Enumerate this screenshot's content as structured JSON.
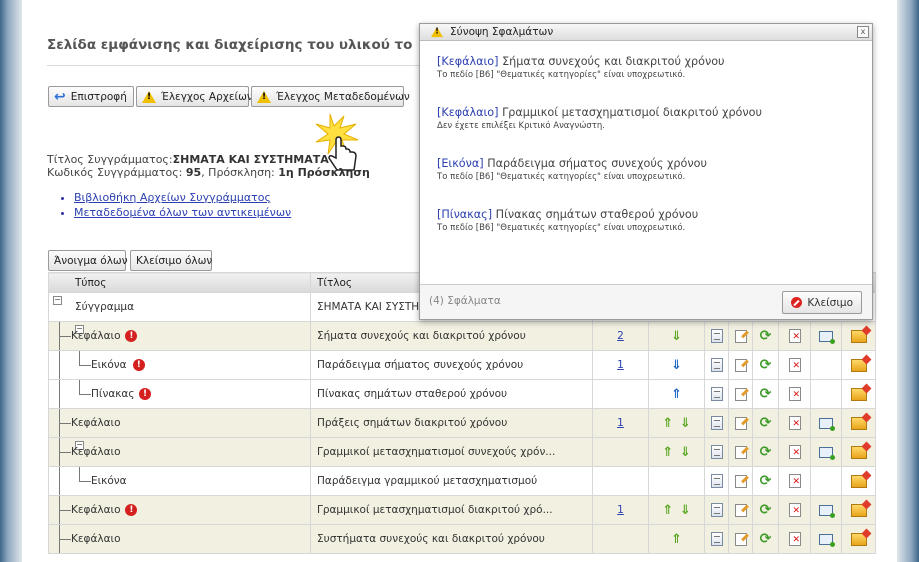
{
  "page": {
    "title": "Σελίδα εμφάνισης και διαχείρισης του υλικού το",
    "buttons": {
      "back": "Επιστροφή",
      "check_files": "Έλεγχος Αρχείων",
      "check_metadata": "Έλεγχος Μεταδεδομένων"
    },
    "book_title_label": "Τίτλος Συγγράμματος:",
    "book_title_value": "ΣΗΜΑΤΑ ΚΑΙ ΣΥΣΤΗΜΑΤΑ",
    "book_code_label": "Κωδικός Συγγράμματος:",
    "book_code_value": "95",
    "invitation_label": ", Πρόσκληση:",
    "invitation_value": "1η Πρόσκληση",
    "links": [
      "Βιβλιοθήκη Αρχείων Συγγράμματος",
      "Μεταδεδομένα όλων των αντικειμένων"
    ],
    "expand_all": "Άνοιγμα όλων",
    "collapse_all": "Κλείσιμο όλων"
  },
  "table": {
    "headers": {
      "type": "Τύπος",
      "title": "Τίτλος"
    },
    "rows": [
      {
        "type": "Σύγγραμμα",
        "title": "ΣΗΜΑΤΑ ΚΑΙ ΣΥΣΤΗΜΑ",
        "count": "",
        "err": false
      },
      {
        "type": "Κεφάλαιο",
        "title": "Σήματα συνεχούς και διακριτού χρόνου",
        "count": "2",
        "err": true
      },
      {
        "type": "Εικόνα",
        "title": "Παράδειγμα σήματος συνεχούς χρόνου",
        "count": "1",
        "err": true
      },
      {
        "type": "Πίνακας",
        "title": "Πίνακας σημάτων σταθερού χρόνου",
        "count": "",
        "err": true
      },
      {
        "type": "Κεφάλαιο",
        "title": "Πράξεις σημάτων διακριτού χρόνου",
        "count": "1",
        "err": false
      },
      {
        "type": "Κεφάλαιο",
        "title": "Γραμμικοί μετασχηματισμοί συνεχούς χρόν...",
        "count": "",
        "err": false
      },
      {
        "type": "Εικόνα",
        "title": "Παράδειγμα γραμμικού μετασχηματισμού",
        "count": "",
        "err": false
      },
      {
        "type": "Κεφάλαιο",
        "title": "Γραμμικοί μετασχηματισμοί διακριτού χρό...",
        "count": "1",
        "err": true
      },
      {
        "type": "Κεφάλαιο",
        "title": "Συστήματα συνεχούς και διακριτού χρόνου",
        "count": "",
        "err": false
      }
    ]
  },
  "dialog": {
    "title": "Σύνοψη Σφαλμάτων",
    "errors": [
      {
        "tag": "[Κεφάλαιο]",
        "name": "Σήματα συνεχούς και διακριτού χρόνου",
        "msg": "Το πεδίο [Β6] \"Θεματικές κατηγορίες\" είναι υποχρεωτικό."
      },
      {
        "tag": "[Κεφάλαιο]",
        "name": "Γραμμικοί μετασχηματισμοί διακριτού χρόνου",
        "msg": "Δεν έχετε επιλέξει Κριτικό Αναγνώστη."
      },
      {
        "tag": "[Εικόνα]",
        "name": "Παράδειγμα σήματος συνεχούς χρόνου",
        "msg": "Το πεδίο [Β6] \"Θεματικές κατηγορίες\" είναι υποχρεωτικό."
      },
      {
        "tag": "[Πίνακας]",
        "name": "Πίνακας σημάτων σταθερού χρόνου",
        "msg": "Το πεδίο [Β6] \"Θεματικές κατηγορίες\" είναι υποχρεωτικό."
      }
    ],
    "count_text": "(4) Σφάλματα",
    "close_label": "Κλείσιμο",
    "close_x": "x"
  },
  "colors": {
    "error": "#d52020",
    "link": "#2b3fb0",
    "row_alt": "#f2f0e1"
  }
}
